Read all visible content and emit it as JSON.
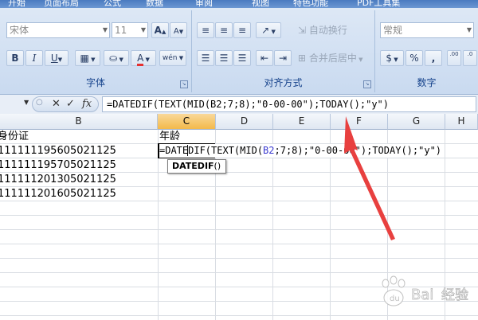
{
  "ribbon": {
    "tabs": [
      "开始",
      "页面布局",
      "公式",
      "数据",
      "审阅",
      "视图",
      "特色功能",
      "PDF工具集"
    ],
    "font_group": {
      "label": "字体",
      "font_name": "宋体",
      "font_size": "11",
      "bold": "B",
      "italic": "I",
      "underline": "U",
      "grow_font": "A",
      "shrink_font": "A",
      "phonetic": "wén",
      "font_color": "A"
    },
    "alignment_group": {
      "label": "对齐方式",
      "wrap_text": "自动换行",
      "merge_center": "合并后居中"
    },
    "number_group": {
      "label": "数字",
      "format": "常规",
      "currency": "$",
      "percent": "%",
      "comma": ",",
      "inc_decimal": ".00",
      "dec_decimal": ".0"
    }
  },
  "formula_bar": {
    "fx": "fx",
    "formula": "=DATEDIF(TEXT(MID(B2;7;8);\"0-00-00\");TODAY();\"y\")"
  },
  "columns": [
    "B",
    "C",
    "D",
    "E",
    "F",
    "G",
    "H"
  ],
  "cells": {
    "b1": "身份证",
    "c1": "年龄",
    "b_values": [
      "111111195605021125",
      "111111195705021125",
      "111111201305021125",
      "111111201605021125"
    ]
  },
  "edit": {
    "part1": "=DATE",
    "part2": "DIF(TEXT(MID(",
    "ref": "B2",
    "part3": ";7;8);\"0-00-00\");TODAY();\"y\")"
  },
  "tooltip": {
    "name": "DATEDIF",
    "parens": "()"
  },
  "colors": {
    "ribbon": "#c9daf0",
    "active_column": "#f3b94b",
    "arrow": "#e8403f",
    "cell_ref": "#3a3ad0"
  }
}
